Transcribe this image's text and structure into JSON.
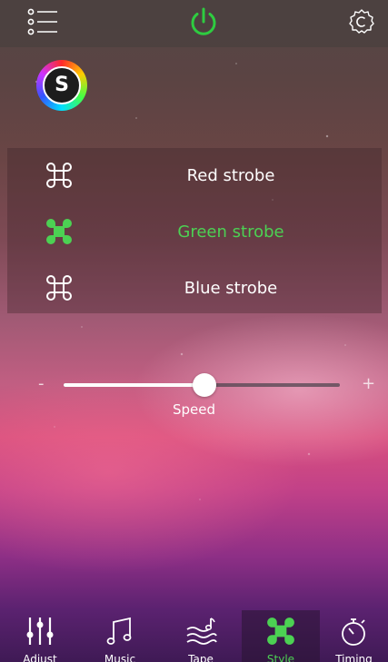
{
  "colors": {
    "accent": "#4cd153",
    "text": "#ffffff"
  },
  "header": {
    "menu_icon": "list-menu-icon",
    "power_icon": "power-icon",
    "settings_icon": "gear-icon"
  },
  "logo": {
    "letter": "S"
  },
  "strobes": [
    {
      "label": "Red strobe",
      "active": false,
      "icon": "command-icon"
    },
    {
      "label": "Green strobe",
      "active": true,
      "icon": "command-icon"
    },
    {
      "label": "Blue strobe",
      "active": false,
      "icon": "command-icon"
    }
  ],
  "speed": {
    "label": "Speed",
    "minus": "-",
    "plus": "+",
    "value_percent": 51
  },
  "nav": {
    "items": [
      {
        "label": "Adjust",
        "icon": "sliders-icon",
        "active": false
      },
      {
        "label": "Music",
        "icon": "music-note-icon",
        "active": false
      },
      {
        "label": "Tape",
        "icon": "waves-icon",
        "active": false
      },
      {
        "label": "Style",
        "icon": "command-icon",
        "active": true
      },
      {
        "label": "Timing",
        "icon": "stopwatch-icon",
        "active": false
      }
    ]
  }
}
